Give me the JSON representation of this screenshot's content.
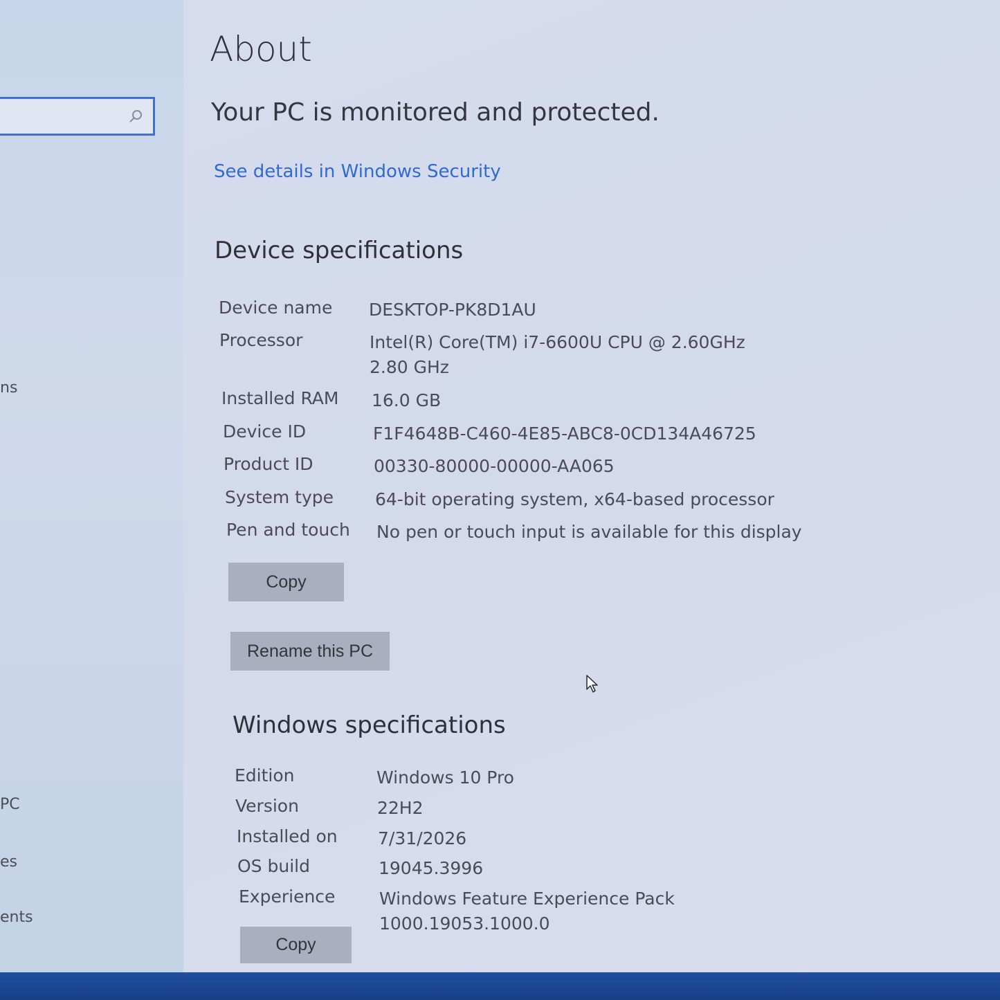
{
  "page": {
    "title": "About",
    "status_text": "Your PC is monitored and protected.",
    "security_link": "See details in Windows Security"
  },
  "sidebar": {
    "items": [
      {
        "label": "ns"
      },
      {
        "label": "PC"
      },
      {
        "label": "es"
      },
      {
        "label": "ents"
      }
    ]
  },
  "device_specs": {
    "heading": "Device specifications",
    "rows": [
      {
        "label": "Device name",
        "value": "DESKTOP-PK8D1AU"
      },
      {
        "label": "Processor",
        "value": "Intel(R) Core(TM) i7-6600U CPU @ 2.60GHz   2.80 GHz"
      },
      {
        "label": "Installed RAM",
        "value": "16.0 GB"
      },
      {
        "label": "Device ID",
        "value": "F1F4648B-C460-4E85-ABC8-0CD134A46725"
      },
      {
        "label": "Product ID",
        "value": "00330-80000-00000-AA065"
      },
      {
        "label": "System type",
        "value": "64-bit operating system, x64-based processor"
      },
      {
        "label": "Pen and touch",
        "value": "No pen or touch input is available for this display"
      }
    ],
    "copy_label": "Copy",
    "rename_label": "Rename this PC"
  },
  "windows_specs": {
    "heading": "Windows specifications",
    "rows": [
      {
        "label": "Edition",
        "value": "Windows 10 Pro"
      },
      {
        "label": "Version",
        "value": "22H2"
      },
      {
        "label": "Installed on",
        "value": "7/31/2026"
      },
      {
        "label": "OS build",
        "value": "19045.3996"
      },
      {
        "label": "Experience",
        "value": "Windows Feature Experience Pack 1000.19053.1000.0"
      }
    ],
    "copy_label": "Copy"
  },
  "colors": {
    "accent": "#3f6fd0",
    "link": "#2f6bd0",
    "button": "#a9afbf",
    "taskbar": "#1f4f9f"
  }
}
